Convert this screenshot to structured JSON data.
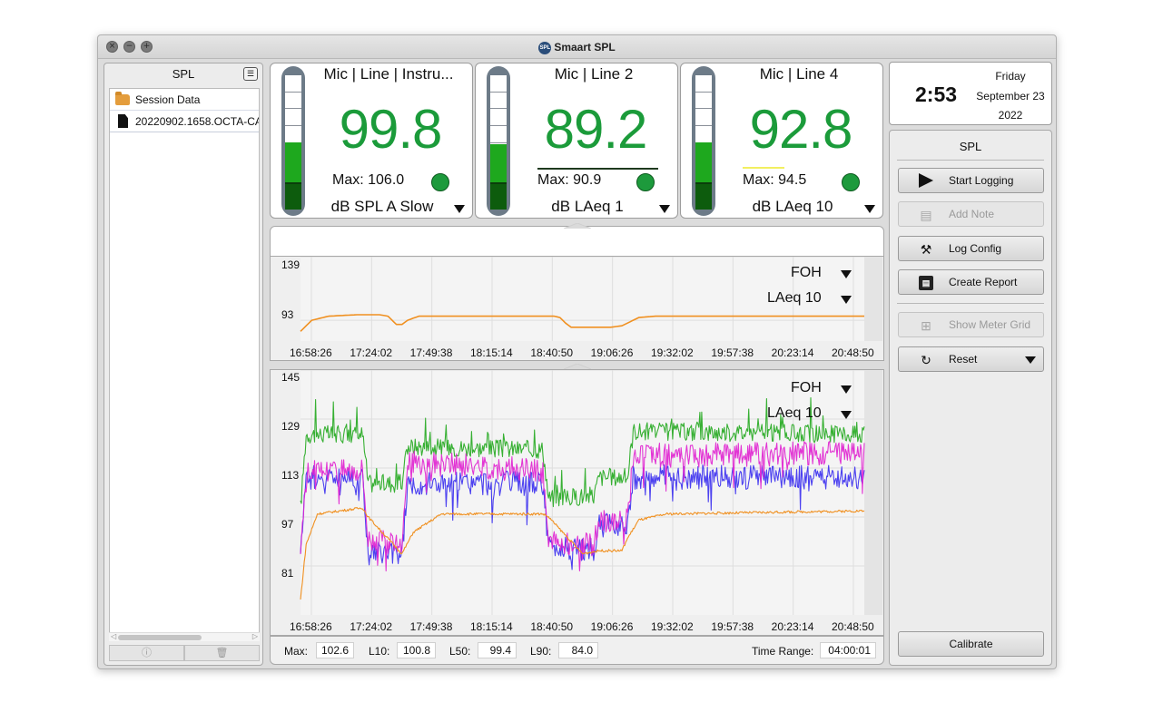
{
  "window": {
    "title": "Smaart SPL",
    "controls": {
      "close": "×",
      "minimize": "−",
      "zoom": "+"
    }
  },
  "left_panel": {
    "title": "SPL",
    "menu_icon": "list-icon",
    "tree": [
      {
        "label": "Session Data",
        "icon": "folder-icon"
      },
      {
        "label": "20220902.1658.OCTA-CA",
        "icon": "file-icon"
      }
    ],
    "footer_icons": [
      "info-icon",
      "trash-icon"
    ]
  },
  "meters": [
    {
      "title": "Mic | Line | Instru...",
      "value": "99.8",
      "max_label": "Max: 106.0",
      "unit": "dB SPL A Slow",
      "level_fraction": 0.31
    },
    {
      "title": "Mic | Line 2",
      "value": "89.2",
      "max_label": "Max: 90.9",
      "unit": "dB LAeq 1",
      "level_fraction": 0.3
    },
    {
      "title": "Mic | Line 4",
      "value": "92.8",
      "max_label": "Max: 94.5",
      "unit": "dB LAeq 10",
      "level_fraction": 0.31
    }
  ],
  "clock": {
    "time": "2:53",
    "day": "Friday",
    "date": "September 23",
    "year": "2022"
  },
  "colors": {
    "value_green": "#1b9b3a",
    "orange": "#f09020",
    "green": "#22a81e",
    "blue": "#3a2ef0",
    "magenta": "#e020d0",
    "red": "#e0306a"
  },
  "chart_data": [
    {
      "type": "line",
      "x_ticks": [
        "16:58:26",
        "17:24:02",
        "17:49:38",
        "18:15:14",
        "18:40:50",
        "19:06:26",
        "19:32:02",
        "19:57:38",
        "20:23:14",
        "20:48:50"
      ],
      "y_ticks": [
        "139",
        "93"
      ],
      "ylim": [
        78,
        139
      ],
      "overlay_labels": {
        "channel": "FOH",
        "metric": "LAeq 10"
      },
      "series": [
        {
          "color": "#f09020",
          "x": [
            0,
            0.02,
            0.05,
            0.1,
            0.14,
            0.155,
            0.17,
            0.18,
            0.19,
            0.21,
            0.3,
            0.4,
            0.45,
            0.46,
            0.47,
            0.48,
            0.5,
            0.55,
            0.57,
            0.59,
            0.6,
            0.63,
            0.7,
            0.8,
            0.9,
            1.0
          ],
          "values": [
            85,
            93,
            96,
            97,
            97,
            96,
            90,
            90,
            93,
            96,
            96,
            96,
            96,
            95,
            91,
            88,
            88,
            88,
            89,
            93,
            95,
            96,
            96,
            96,
            96,
            96
          ]
        }
      ]
    },
    {
      "type": "line",
      "x_ticks": [
        "16:58:26",
        "17:24:02",
        "17:49:38",
        "18:15:14",
        "18:40:50",
        "19:06:26",
        "19:32:02",
        "19:57:38",
        "20:23:14",
        "20:48:50"
      ],
      "y_ticks": [
        "145",
        "129",
        "113",
        "97",
        "81"
      ],
      "ylim": [
        65,
        145
      ],
      "overlay_labels": {
        "channel": "FOH",
        "metric": "LAeq 10"
      },
      "series": [
        {
          "color": "#22a81e",
          "x": [
            0,
            0.01,
            0.11,
            0.12,
            0.18,
            0.19,
            0.43,
            0.44,
            0.52,
            0.53,
            0.58,
            0.59,
            1.0
          ],
          "values": [
            100,
            124,
            124,
            108,
            108,
            120,
            119,
            103,
            104,
            110,
            110,
            125,
            124
          ]
        },
        {
          "color": "#3a2ef0",
          "x": [
            0,
            0.01,
            0.11,
            0.12,
            0.18,
            0.19,
            0.43,
            0.44,
            0.52,
            0.53,
            0.58,
            0.59,
            1.0
          ],
          "values": [
            88,
            110,
            110,
            85,
            85,
            108,
            108,
            87,
            86,
            94,
            95,
            110,
            110
          ]
        },
        {
          "color": "#e020d0",
          "x": [
            0,
            0.01,
            0.11,
            0.12,
            0.18,
            0.19,
            0.43,
            0.44,
            0.52,
            0.53,
            0.58,
            0.59,
            1.0
          ],
          "values": [
            86,
            112,
            113,
            90,
            88,
            115,
            112,
            89,
            88,
            96,
            96,
            117,
            118
          ]
        },
        {
          "color": "#f09020",
          "x": [
            0,
            0.01,
            0.03,
            0.11,
            0.12,
            0.17,
            0.18,
            0.2,
            0.25,
            0.43,
            0.44,
            0.5,
            0.53,
            0.57,
            0.58,
            0.6,
            0.65,
            1.0
          ],
          "values": [
            70,
            88,
            98,
            100,
            97,
            87,
            85,
            92,
            98,
            98,
            97,
            85,
            86,
            86,
            90,
            96,
            98,
            99
          ]
        }
      ]
    }
  ],
  "chart_overlays": {
    "top": {
      "channel": "FOH",
      "metric": "LAeq 10"
    },
    "bottom": {
      "channel": "FOH",
      "metric": "LAeq 10"
    }
  },
  "stats": {
    "max_label": "Max:",
    "max_value": "102.6",
    "l10_label": "L10:",
    "l10_value": "100.8",
    "l50_label": "L50:",
    "l50_value": "99.4",
    "l90_label": "L90:",
    "l90_value": "84.0",
    "range_label": "Time Range:",
    "range_value": "04:00:01"
  },
  "right_panel": {
    "title": "SPL",
    "buttons": [
      {
        "label": "Start Logging",
        "icon": "play-icon",
        "enabled": true
      },
      {
        "label": "Add Note",
        "icon": "note-icon",
        "enabled": false
      },
      {
        "label": "Log Config",
        "icon": "tools-icon",
        "enabled": true
      },
      {
        "label": "Create Report",
        "icon": "pdf-icon",
        "enabled": true
      },
      {
        "label": "Show Meter Grid",
        "icon": "grid-icon",
        "enabled": false
      },
      {
        "label": "Reset",
        "icon": "reset-icon",
        "enabled": true
      },
      {
        "label": "Calibrate",
        "icon": "",
        "enabled": true
      }
    ]
  }
}
